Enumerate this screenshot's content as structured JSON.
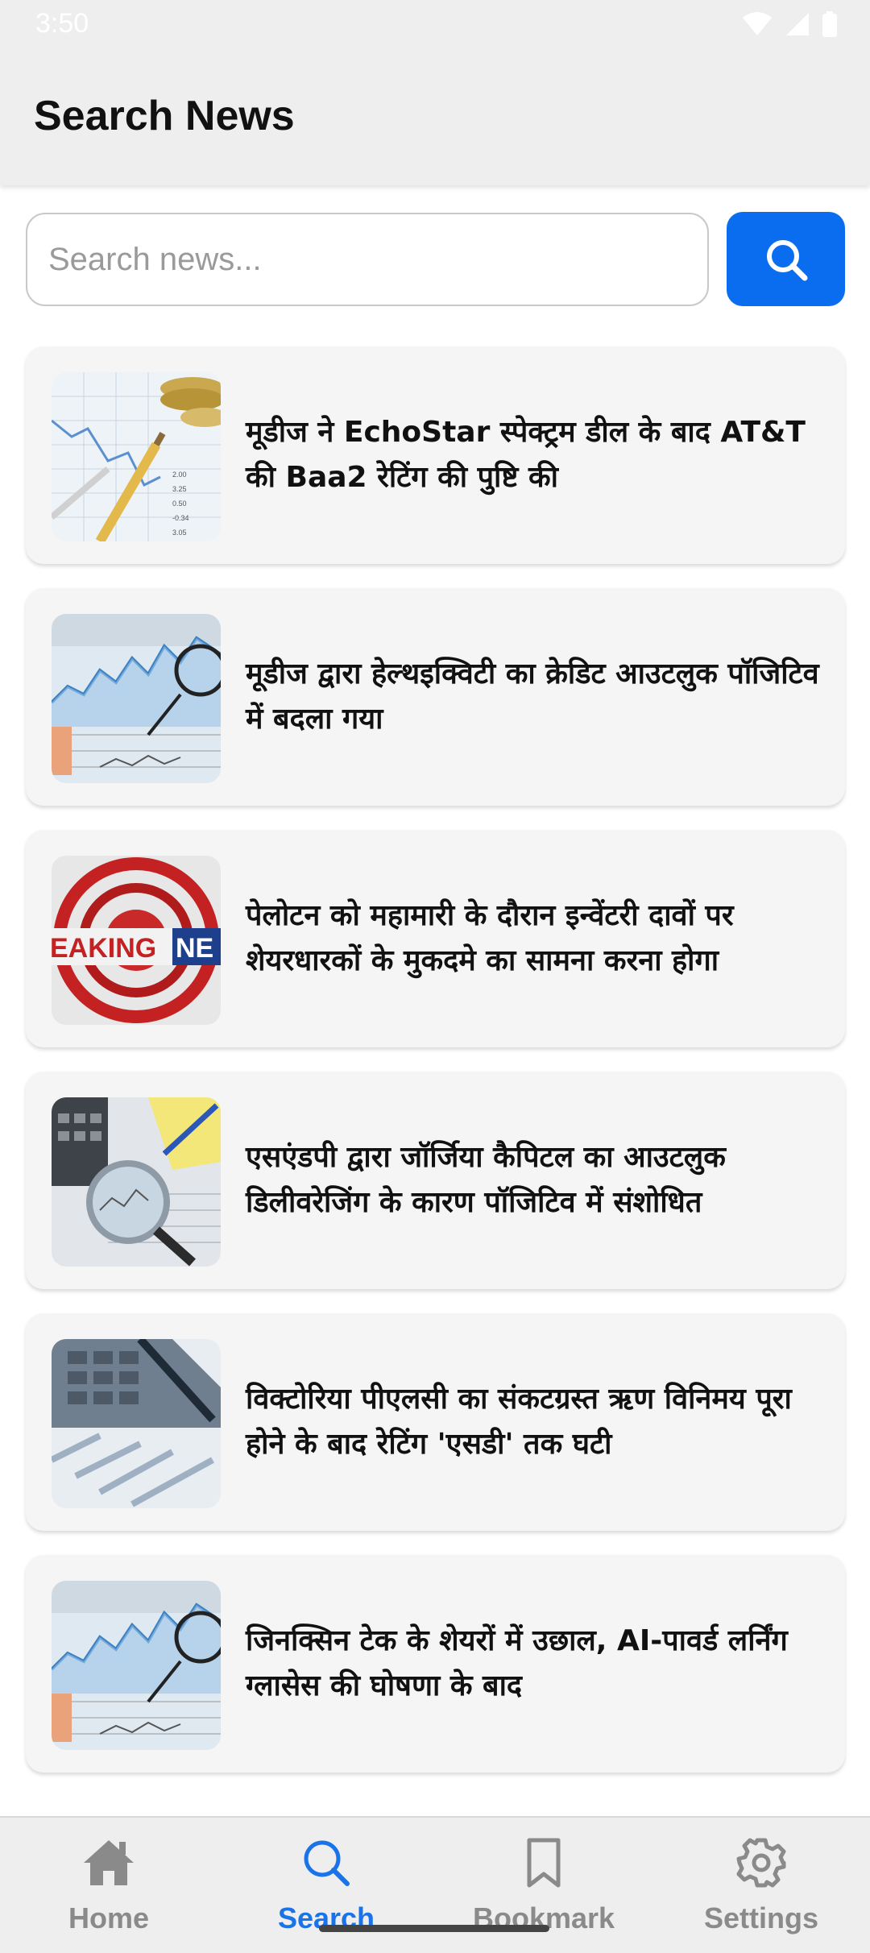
{
  "status_bar": {
    "time": "3:50"
  },
  "header": {
    "title": "Search News"
  },
  "search": {
    "placeholder": "Search news...",
    "value": ""
  },
  "articles": [
    {
      "title": "मूडीज ने EchoStar स्पेक्ट्रम डील के बाद AT&T की Baa2 रेटिंग की पुष्टि की",
      "image": "coins-finance-chart-image"
    },
    {
      "title": "मूडीज द्वारा हेल्थइक्विटी का क्रेडिट आउटलुक पॉजिटिव में बदला गया",
      "image": "stock-chart-glasses-image"
    },
    {
      "title": "पेलोटन को महामारी के दौरान इन्वेंटरी दावों पर शेयरधारकों के मुकदमे का सामना करना होगा",
      "image": "breaking-news-image"
    },
    {
      "title": "एसएंडपी द्वारा जॉर्जिया कैपिटल का आउटलुक डिलीवरेजिंग के कारण पॉजिटिव में संशोधित",
      "image": "magnifier-calculator-image"
    },
    {
      "title": "विक्टोरिया पीएलसी का संकटग्रस्त ऋण विनिमय पूरा होने के बाद रेटिंग 'एसडी' तक घटी",
      "image": "calculator-pen-image"
    },
    {
      "title": "जिनक्सिन टेक के शेयरों में उछाल, AI-पावर्ड लर्निंग ग्लासेस की घोषणा के बाद",
      "image": "stock-chart-glasses-image"
    }
  ],
  "bottom_nav": {
    "items": [
      {
        "label": "Home",
        "icon": "home-icon",
        "active": false
      },
      {
        "label": "Search",
        "icon": "search-icon",
        "active": true
      },
      {
        "label": "Bookmark",
        "icon": "bookmark-icon",
        "active": false
      },
      {
        "label": "Settings",
        "icon": "settings-icon",
        "active": false
      }
    ]
  },
  "colors": {
    "accent": "#0a6df0",
    "active_nav": "#1a73e8",
    "inactive_nav": "#8a8a8a"
  }
}
